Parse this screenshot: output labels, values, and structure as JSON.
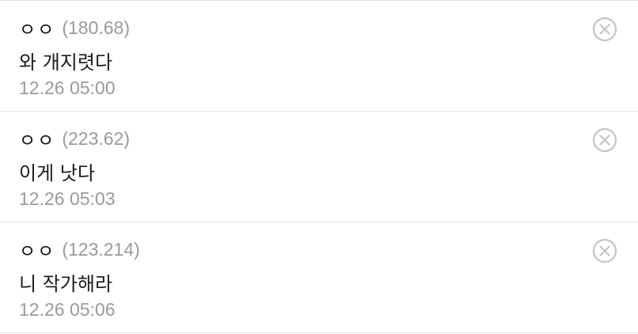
{
  "comments": [
    {
      "nick": "ㅇㅇ",
      "ip": "(180.68)",
      "text": "와 개지렷다",
      "time": "12.26 05:00",
      "delete_icon": "circle-x-icon"
    },
    {
      "nick": "ㅇㅇ",
      "ip": "(223.62)",
      "text": "이게 낫다",
      "time": "12.26 05:03",
      "delete_icon": "circle-x-icon"
    },
    {
      "nick": "ㅇㅇ",
      "ip": "(123.214)",
      "text": "니 작가해라",
      "time": "12.26 05:06",
      "delete_icon": "circle-x-icon"
    }
  ],
  "colors": {
    "text": "#1a1a1a",
    "meta": "#9a9a9a",
    "divider": "#e3e3e8",
    "icon": "#c4c4c8"
  }
}
